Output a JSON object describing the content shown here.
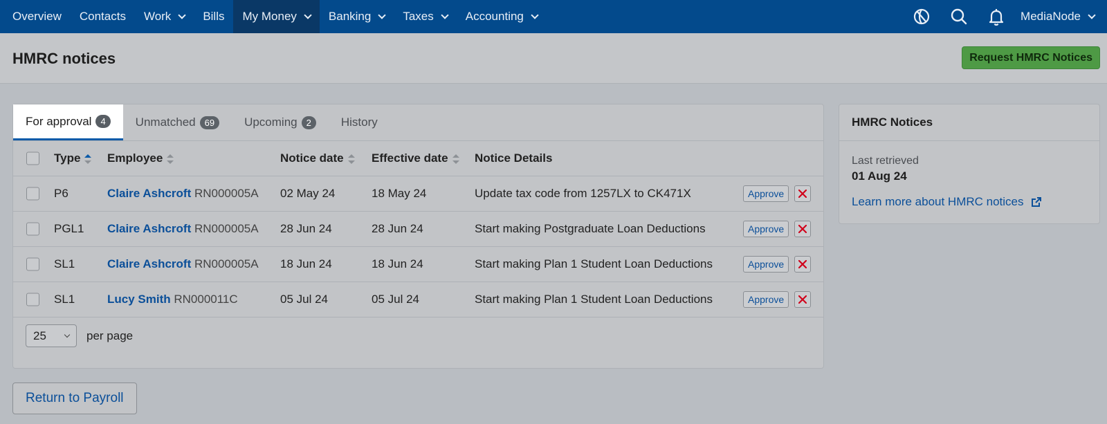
{
  "nav": {
    "items": [
      {
        "label": "Overview",
        "dropdown": false,
        "active": false
      },
      {
        "label": "Contacts",
        "dropdown": false,
        "active": false
      },
      {
        "label": "Work",
        "dropdown": true,
        "active": false
      },
      {
        "label": "Bills",
        "dropdown": false,
        "active": false
      },
      {
        "label": "My Money",
        "dropdown": true,
        "active": true
      },
      {
        "label": "Banking",
        "dropdown": true,
        "active": false
      },
      {
        "label": "Taxes",
        "dropdown": true,
        "active": false
      },
      {
        "label": "Accounting",
        "dropdown": true,
        "active": false
      }
    ],
    "icons": [
      "sync-icon",
      "search-icon",
      "bell-icon"
    ],
    "user_label": "MediaNode"
  },
  "header": {
    "title": "HMRC notices",
    "request_button": "Request HMRC Notices"
  },
  "tabs": [
    {
      "label": "For approval",
      "count": "4",
      "active": true
    },
    {
      "label": "Unmatched",
      "count": "69",
      "active": false
    },
    {
      "label": "Upcoming",
      "count": "2",
      "active": false
    },
    {
      "label": "History",
      "count": null,
      "active": false
    }
  ],
  "table": {
    "columns": {
      "type": "Type",
      "employee": "Employee",
      "notice_date": "Notice date",
      "effective_date": "Effective date",
      "details": "Notice Details"
    },
    "approve_label": "Approve",
    "rows": [
      {
        "type": "P6",
        "employee_name": "Claire Ashcroft",
        "employee_ni": "RN000005A",
        "notice_date": "02 May 24",
        "effective_date": "18 May 24",
        "details": "Update tax code from 1257LX to CK471X"
      },
      {
        "type": "PGL1",
        "employee_name": "Claire Ashcroft",
        "employee_ni": "RN000005A",
        "notice_date": "28 Jun 24",
        "effective_date": "28 Jun 24",
        "details": "Start making Postgraduate Loan Deductions"
      },
      {
        "type": "SL1",
        "employee_name": "Claire Ashcroft",
        "employee_ni": "RN000005A",
        "notice_date": "18 Jun 24",
        "effective_date": "18 Jun 24",
        "details": "Start making Plan 1 Student Loan Deductions"
      },
      {
        "type": "SL1",
        "employee_name": "Lucy Smith",
        "employee_ni": "RN000011C",
        "notice_date": "05 Jul 24",
        "effective_date": "05 Jul 24",
        "details": "Start making Plan 1 Student Loan Deductions"
      }
    ]
  },
  "pagination": {
    "per_page_value": "25",
    "per_page_label": "per page"
  },
  "side": {
    "title": "HMRC Notices",
    "last_retrieved_label": "Last retrieved",
    "last_retrieved_value": "01 Aug 24",
    "learn_more": "Learn more about HMRC notices"
  },
  "footer": {
    "return_button": "Return to Payroll"
  },
  "colors": {
    "nav_bg": "#034a8c",
    "nav_active_bg": "#0a3866",
    "accent_green": "#4e9a45",
    "link_blue": "#0b4f99",
    "reject_red": "#d0021b"
  }
}
